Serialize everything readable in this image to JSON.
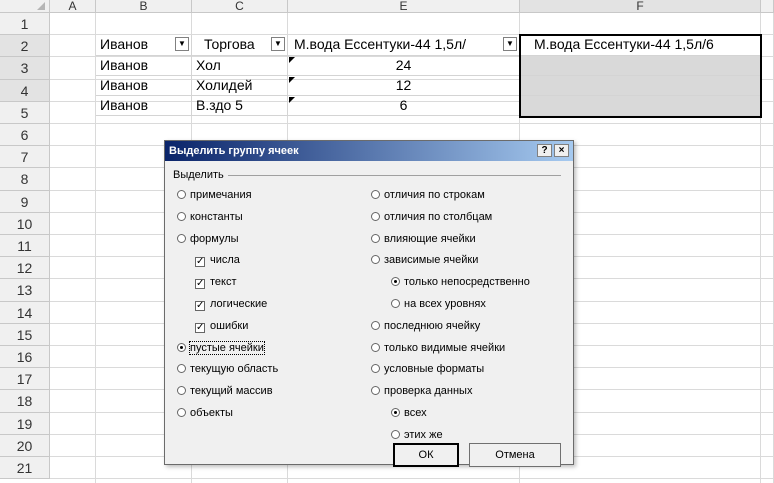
{
  "columns": [
    "A",
    "B",
    "C",
    "E",
    "F"
  ],
  "rows": [
    "1",
    "2",
    "3",
    "4",
    "5",
    "6",
    "7",
    "8",
    "9",
    "10",
    "11",
    "12",
    "13",
    "14",
    "15",
    "16",
    "17",
    "18",
    "19",
    "20",
    "21"
  ],
  "cells": {
    "B1": "Иванов",
    "C1": "Торгова",
    "E1": "М.вода Ессентуки-44  1,5л/",
    "F1": "М.вода Ессентуки-44  1,5л/6",
    "B2": "Иванов",
    "C2": "Хол",
    "E2": "24",
    "B3": "Иванов",
    "C3": "Холидей",
    "E3": "12",
    "B4": "Иванов",
    "C4": "В.здо 5",
    "E4": "6"
  },
  "filter_icon": "dropdown-arrow-icon",
  "dialog": {
    "title": "Выделить группу ячеек",
    "help": "?",
    "close": "×",
    "group_label": "Выделить",
    "left_options": [
      {
        "label": "примечания",
        "type": "radio",
        "selected": false
      },
      {
        "label": "константы",
        "type": "radio",
        "selected": false
      },
      {
        "label": "формулы",
        "type": "radio",
        "selected": false
      },
      {
        "label": "числа",
        "type": "check",
        "checked": true
      },
      {
        "label": "текст",
        "type": "check",
        "checked": true
      },
      {
        "label": "логические",
        "type": "check",
        "checked": true
      },
      {
        "label": "ошибки",
        "type": "check",
        "checked": true
      },
      {
        "label": "пустые ячейки",
        "type": "radio",
        "selected": true
      },
      {
        "label": "текущую область",
        "type": "radio",
        "selected": false
      },
      {
        "label": "текущий массив",
        "type": "radio",
        "selected": false
      },
      {
        "label": "объекты",
        "type": "radio",
        "selected": false
      }
    ],
    "right_options": [
      {
        "label": "отличия по строкам",
        "type": "radio",
        "selected": false
      },
      {
        "label": "отличия по столбцам",
        "type": "radio",
        "selected": false
      },
      {
        "label": "влияющие ячейки",
        "type": "radio",
        "selected": false
      },
      {
        "label": "зависимые ячейки",
        "type": "radio",
        "selected": false
      },
      {
        "label": "только непосредственно",
        "type": "radio",
        "selected": true
      },
      {
        "label": "на всех уровнях",
        "type": "radio",
        "selected": false
      },
      {
        "label": "последнюю ячейку",
        "type": "radio",
        "selected": false
      },
      {
        "label": "только видимые ячейки",
        "type": "radio",
        "selected": false
      },
      {
        "label": "условные форматы",
        "type": "radio",
        "selected": false
      },
      {
        "label": "проверка данных",
        "type": "radio",
        "selected": false
      },
      {
        "label": "всех",
        "type": "radio",
        "selected": true
      },
      {
        "label": "этих же",
        "type": "radio",
        "selected": false
      }
    ],
    "ok_label": "ОК",
    "cancel_label": "Отмена"
  }
}
